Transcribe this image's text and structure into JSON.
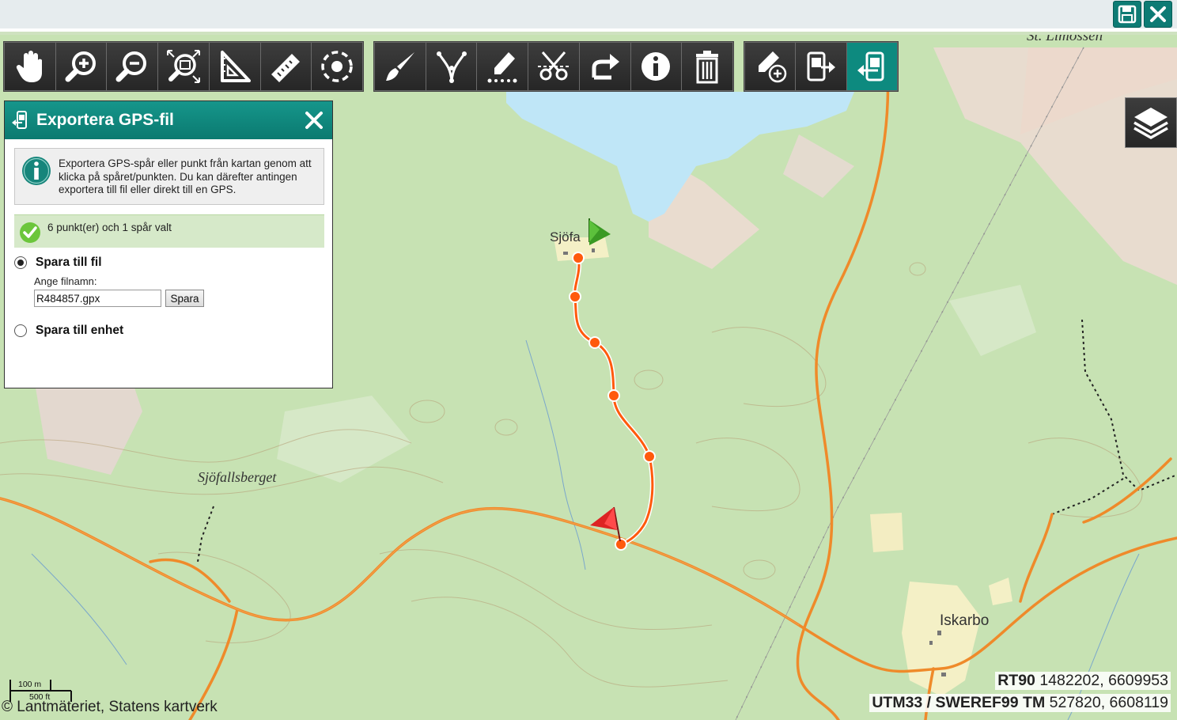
{
  "topbar": {
    "save_icon": "save-icon",
    "close_icon": "close-icon"
  },
  "toolbars": [
    {
      "name": "navigation",
      "tools": [
        {
          "icon": "hand-pan-icon"
        },
        {
          "icon": "zoom-in-icon"
        },
        {
          "icon": "zoom-out-icon"
        },
        {
          "icon": "zoom-extent-icon"
        },
        {
          "icon": "measure-area-icon"
        },
        {
          "icon": "ruler-icon"
        },
        {
          "icon": "locate-position-icon"
        }
      ]
    },
    {
      "name": "editing",
      "tools": [
        {
          "icon": "brush-icon"
        },
        {
          "icon": "draw-line-icon"
        },
        {
          "icon": "draw-freehand-icon"
        },
        {
          "icon": "cut-line-icon"
        },
        {
          "icon": "redo-icon"
        },
        {
          "icon": "info-icon"
        },
        {
          "icon": "delete-icon"
        }
      ]
    },
    {
      "name": "gps",
      "tools": [
        {
          "icon": "add-point-icon"
        },
        {
          "icon": "gps-import-icon"
        },
        {
          "icon": "gps-export-icon",
          "active": true
        }
      ]
    }
  ],
  "layers_button": {
    "icon": "layers-icon"
  },
  "panel": {
    "title": "Exportera GPS-fil",
    "info_text": "Exportera GPS-spår eller punkt från kartan genom att klicka på spåret/punkten. Du kan därefter antingen exportera till fil eller direkt till en GPS.",
    "status_text": "6 punkt(er) och 1 spår valt",
    "option_file_label": "Spara till fil",
    "option_file_selected": true,
    "filename_label": "Ange filnamn:",
    "filename_value": "R484857.gpx",
    "save_button_label": "Spara",
    "option_device_label": "Spara till enhet",
    "option_device_selected": false
  },
  "map": {
    "labels": {
      "top_right": "St. Limossen",
      "hill": "Sjöfallsberget",
      "village_north": "Sjöfa",
      "village_east": "Iskarbo"
    },
    "colors": {
      "track": "#ff5a0d",
      "road": "#ef8a2a",
      "water": "#bfe6f7",
      "forest": "#c4e0b0",
      "start_flag": "#3a9a24",
      "end_flag": "#dd2323"
    }
  },
  "scale": {
    "metric": "100 m",
    "imperial": "500 ft"
  },
  "copyright": "© Lantmäteriet, Statens kartverk",
  "coords": {
    "rt90_label": "RT90",
    "rt90_value": "1482202, 6609953",
    "utm_label": "UTM33 / SWEREF99 TM",
    "utm_value": "527820, 6608119"
  }
}
